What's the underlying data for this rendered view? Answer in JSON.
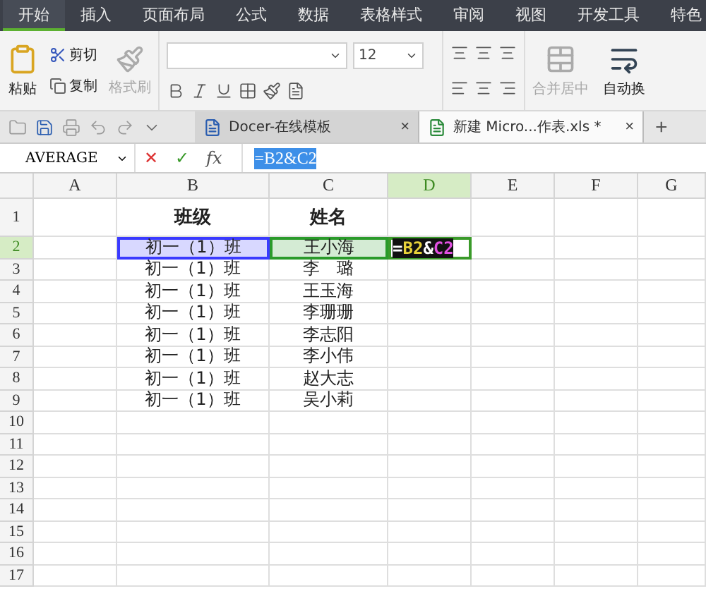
{
  "menu_tabs": [
    {
      "label": "开始",
      "selected": true
    },
    {
      "label": "插入",
      "selected": false
    },
    {
      "label": "页面布局",
      "selected": false
    },
    {
      "label": "公式",
      "selected": false
    },
    {
      "label": "数据",
      "selected": false
    },
    {
      "label": "表格样式",
      "selected": false
    },
    {
      "label": "审阅",
      "selected": false
    },
    {
      "label": "视图",
      "selected": false
    },
    {
      "label": "开发工具",
      "selected": false
    },
    {
      "label": "特色",
      "selected": false
    }
  ],
  "clipboard": {
    "paste": "粘贴",
    "cut": "剪切",
    "copy": "复制",
    "format_painter": {
      "label": "格式刷",
      "disabled": true
    }
  },
  "font": {
    "size": "12"
  },
  "merge": {
    "label": "合并居中",
    "disabled": true
  },
  "wrap": {
    "label": "自动换",
    "disabled": false
  },
  "doc_tabs": [
    {
      "title": "Docer-在线模板",
      "close": "×",
      "selected": false
    },
    {
      "title": "新建 Micro...作表.xls *",
      "close": "×",
      "selected": true
    }
  ],
  "new_tab": "+",
  "formula_bar": {
    "name_box": "AVERAGE",
    "cancel": "✕",
    "enter": "✓",
    "fx": "fx",
    "formula": "=B2&C2"
  },
  "columns": [
    {
      "label": "A",
      "selected": false
    },
    {
      "label": "B",
      "selected": false
    },
    {
      "label": "C",
      "selected": false
    },
    {
      "label": "D",
      "selected": true
    },
    {
      "label": "E",
      "selected": false
    },
    {
      "label": "F",
      "selected": false
    },
    {
      "label": "G",
      "selected": false
    }
  ],
  "rows": [
    {
      "label": "1",
      "selected": false,
      "header": true,
      "cells": [
        "",
        "班级",
        "姓名",
        "",
        "",
        "",
        ""
      ]
    },
    {
      "label": "2",
      "selected": true,
      "cells": [
        {
          "text": ""
        },
        {
          "text": "初一（1）班",
          "color": "#3a3aff"
        },
        {
          "text": "王小海",
          "color": "#2a9a2a"
        },
        {
          "kind": "editor",
          "tokens": [
            {
              "text": "=",
              "kind": "operator"
            },
            {
              "text": "B2",
              "kind": "reference"
            },
            {
              "text": "&",
              "kind": "operator"
            },
            {
              "text": "C2",
              "kind": "reference"
            }
          ]
        },
        {
          "text": ""
        },
        {
          "text": ""
        },
        {
          "text": ""
        }
      ]
    },
    {
      "label": "3",
      "selected": false,
      "cells": [
        "",
        "初一（1）班",
        "李　璐",
        "",
        "",
        "",
        ""
      ]
    },
    {
      "label": "4",
      "selected": false,
      "cells": [
        "",
        "初一（1）班",
        "王玉海",
        "",
        "",
        "",
        ""
      ]
    },
    {
      "label": "5",
      "selected": false,
      "cells": [
        "",
        "初一（1）班",
        "李珊珊",
        "",
        "",
        "",
        ""
      ]
    },
    {
      "label": "6",
      "selected": false,
      "cells": [
        "",
        "初一（1）班",
        "李志阳",
        "",
        "",
        "",
        ""
      ]
    },
    {
      "label": "7",
      "selected": false,
      "cells": [
        "",
        "初一（1）班",
        "李小伟",
        "",
        "",
        "",
        ""
      ]
    },
    {
      "label": "8",
      "selected": false,
      "cells": [
        "",
        "初一（1）班",
        "赵大志",
        "",
        "",
        "",
        ""
      ]
    },
    {
      "label": "9",
      "selected": false,
      "cells": [
        "",
        "初一（1）班",
        "吴小莉",
        "",
        "",
        "",
        ""
      ]
    },
    {
      "label": "10",
      "selected": false,
      "cells": [
        "",
        "",
        "",
        "",
        "",
        "",
        ""
      ]
    },
    {
      "label": "11",
      "selected": false,
      "cells": [
        "",
        "",
        "",
        "",
        "",
        "",
        ""
      ]
    },
    {
      "label": "12",
      "selected": false,
      "cells": [
        "",
        "",
        "",
        "",
        "",
        "",
        ""
      ]
    },
    {
      "label": "13",
      "selected": false,
      "cells": [
        "",
        "",
        "",
        "",
        "",
        "",
        ""
      ]
    },
    {
      "label": "14",
      "selected": false,
      "cells": [
        "",
        "",
        "",
        "",
        "",
        "",
        ""
      ]
    },
    {
      "label": "15",
      "selected": false,
      "cells": [
        "",
        "",
        "",
        "",
        "",
        "",
        ""
      ]
    },
    {
      "label": "16",
      "selected": false,
      "cells": [
        "",
        "",
        "",
        "",
        "",
        "",
        ""
      ]
    },
    {
      "label": "17",
      "selected": false,
      "cells": [
        "",
        "",
        "",
        "",
        "",
        "",
        ""
      ]
    }
  ]
}
